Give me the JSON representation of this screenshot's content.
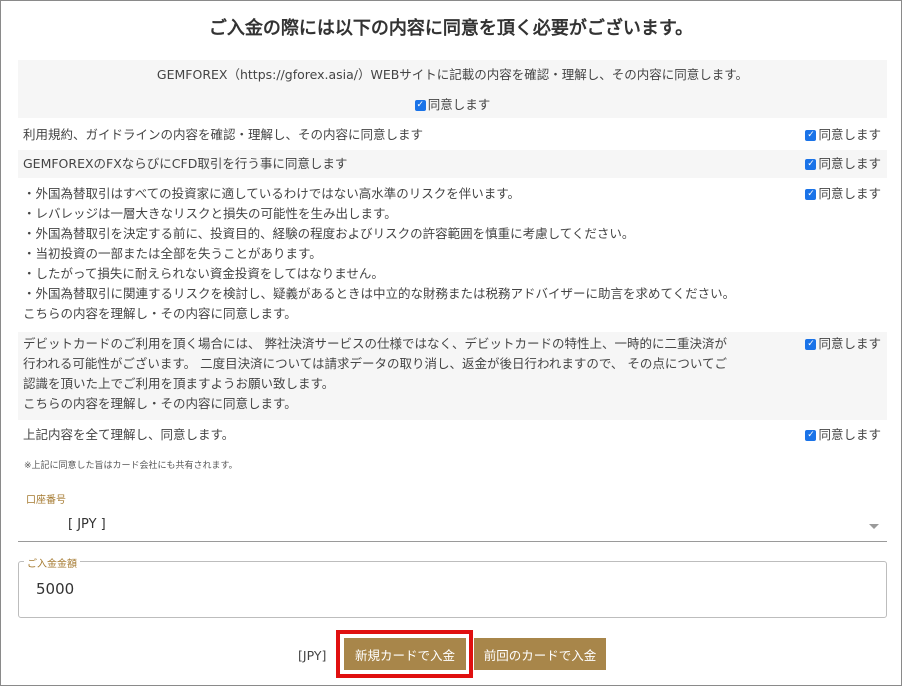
{
  "title": "ご入金の際には以下の内容に同意を頂く必要がございます。",
  "agreement_top": {
    "text": "GEMFOREX（https://gforex.asia/）WEBサイトに記載の内容を確認・理解し、その内容に同意します。",
    "check_label": "同意します"
  },
  "agreements": [
    {
      "lines": [
        "利用規約、ガイドラインの内容を確認・理解し、その内容に同意します"
      ],
      "check_label": "同意します"
    },
    {
      "lines": [
        "GEMFOREXのFXならびにCFD取引を行う事に同意します"
      ],
      "check_label": "同意します"
    },
    {
      "lines": [
        "・外国為替取引はすべての投資家に適しているわけではない高水準のリスクを伴います。",
        "・レバレッジは一層大きなリスクと損失の可能性を生み出します。",
        "・外国為替取引を決定する前に、投資目的、経験の程度およびリスクの許容範囲を慎重に考慮してください。",
        "・当初投資の一部または全部を失うことがあります。",
        "・したがって損失に耐えられない資金投資をしてはなりません。",
        "・外国為替取引に関連するリスクを検討し、疑義があるときは中立的な財務または税務アドバイザーに助言を求めてください。",
        "こちらの内容を理解し・その内容に同意します。"
      ],
      "check_label": "同意します"
    },
    {
      "lines": [
        "デビットカードのご利用を頂く場合には、 弊社決済サービスの仕様ではなく、デビットカードの特性上、一時的に二重決済が",
        "行われる可能性がございます。 二度目決済については請求データの取り消し、返金が後日行われますので、 その点についてご",
        "認識を頂いた上でご利用を頂ますようお願い致します。",
        "こちらの内容を理解し・その内容に同意します。"
      ],
      "check_label": "同意します"
    },
    {
      "lines": [
        "上記内容を全て理解し、同意します。"
      ],
      "check_label": "同意します"
    }
  ],
  "note": "※上記に同意した旨はカード会社にも共有されます。",
  "account": {
    "label": "口座番号",
    "value": "[ JPY ]"
  },
  "amount": {
    "label": "ご入金金額",
    "value": "5000"
  },
  "footer": {
    "currency": "[JPY]",
    "new_card_button": "新規カードで入金",
    "prev_card_button": "前回のカードで入金"
  },
  "colors": {
    "accent": "#a8864a",
    "highlight": "#e01010",
    "checkbox": "#1a73e8"
  }
}
